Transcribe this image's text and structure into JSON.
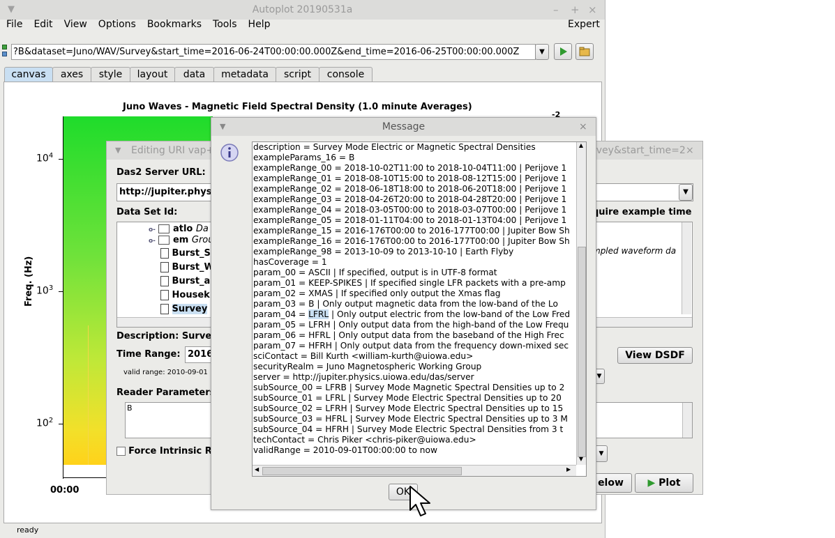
{
  "window": {
    "title": "Autoplot 20190531a",
    "menu": [
      "File",
      "Edit",
      "View",
      "Options",
      "Bookmarks",
      "Tools",
      "Help"
    ],
    "expert_label": "Expert",
    "uri": "?B&dataset=Juno/WAV/Survey&start_time=2016-06-24T00:00:00.000Z&end_time=2016-06-25T00:00:00.000Z",
    "tabs": [
      "canvas",
      "axes",
      "style",
      "layout",
      "data",
      "metadata",
      "script",
      "console"
    ],
    "status": "ready"
  },
  "plot": {
    "title": "Juno Waves - Magnetic Field Spectral Density (1.0 minute Averages)",
    "ylabel": "Freq. (Hz)",
    "ytick_1e4": "10",
    "ytick_1e4_exp": "4",
    "ytick_1e3": "10",
    "ytick_1e3_exp": "3",
    "ytick_1e2": "10",
    "ytick_1e2_exp": "2",
    "xtick_first": "00:00",
    "corner_exp": "-2"
  },
  "editor": {
    "title": "Editing URI vap+das2server:...",
    "title_right": "rvey&start_time=2",
    "server_label": "Das2 Server URL:",
    "server_value": "http://jupiter.physi",
    "dataset_label": "Data Set Id:",
    "tree": [
      {
        "name": "atlo",
        "desc": "Da"
      },
      {
        "name": "em",
        "desc": "Grou"
      },
      {
        "name": "Burst_S"
      },
      {
        "name": "Burst_W"
      },
      {
        "name": "Burst_a"
      },
      {
        "name": "Housek"
      },
      {
        "name": "Survey"
      }
    ],
    "require_example_time": "quire example time",
    "right_desc": "mpled waveform da",
    "description_label": "Description:",
    "description_value": "Survey",
    "time_range_label": "Time Range:",
    "time_range_value": "2016",
    "valid_range": "valid range: 2010-09-01",
    "reader_params_label": "Reader Parameters",
    "reader_params_value": "B",
    "force_intrinsic": "Force Intrinsic Re",
    "view_dsdf": "View DSDF",
    "below_label": "elow",
    "plot_label": "Plot"
  },
  "message": {
    "title": "Message",
    "ok_label": "OK",
    "selected_text": "LFRL",
    "lines": [
      "description  =  Survey Mode Electric or Magnetic Spectral Densities",
      "exampleParams_16  =  B",
      "exampleRange_00  =  2018-10-02T11:00 to 2018-10-04T11:00 | Perijove 1",
      "exampleRange_01  =  2018-08-10T15:00 to 2018-08-12T15:00 | Perijove 1",
      "exampleRange_02  =  2018-06-18T18:00 to 2018-06-20T18:00 | Perijove 1",
      "exampleRange_03  =  2018-04-26T20:00 to 2018-04-28T20:00 | Perijove 1",
      "exampleRange_04  =  2018-03-05T00:00 to 2018-03-07T00:00 | Perijove 1",
      "exampleRange_05  =  2018-01-11T04:00 to 2018-01-13T04:00 | Perijove 1",
      "exampleRange_15  =  2016-176T00:00 to 2016-177T00:00 | Jupiter Bow Sh",
      "exampleRange_16  =  2016-176T00:00 to 2016-177T00:00 | Jupiter Bow Sh",
      "exampleRange_98  =  2013-10-09 to 2013-10-10 | Earth Flyby",
      "hasCoverage  =  1",
      "param_00  =  ASCII | If specified, output is in UTF-8 format",
      "param_01  =  KEEP-SPIKES | If specified single LFR packets with a pre-amp",
      "param_02  =  XMAS | If specified only output the Xmas flag",
      "param_03  =  B    | Only output magnetic data from the low-band of the Lo",
      "param_04  =  ",
      "param_05  =  LFRH | Only output data from the high-band of the Low Frequ",
      "param_06  =  HFRL | Only output data from the baseband of the High Frec",
      "param_07  =  HFRH | Only output data from the frequency down-mixed sec",
      "sciContact  =  Bill Kurth <william-kurth@uiowa.edu>",
      "securityRealm  =  Juno Magnetospheric Working Group",
      "server  =  http://jupiter.physics.uiowa.edu/das/server",
      "subSource_00  =  LFRB | Survey Mode Magnetic Spectral Densities up to 2",
      "subSource_01  =  LFRL | Survey Mode Electric Spectral Densities up to 20",
      "subSource_02  =  LFRH | Survey Mode Electric Spectral Densities up to 15",
      "subSource_03  =  HFRL | Survey Mode Electric Spectral Densities up to 3 M",
      "subSource_04  =  HFRH | Survey Mode Electric Spectral Densities from 3 t",
      "techContact  =  Chris Piker <chris-piker@uiowa.edu>",
      "validRange  =  2010-09-01T00:00:00 to now"
    ],
    "param_04_rest": " | Only output electric from the low-band of the Low Fred"
  }
}
